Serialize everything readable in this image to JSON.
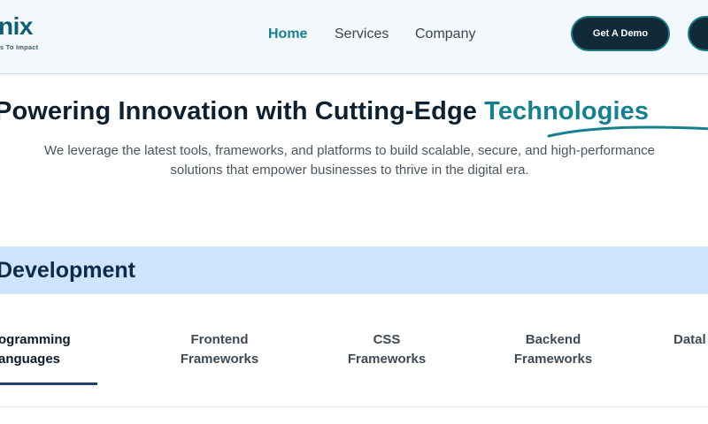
{
  "header": {
    "logo_text": "nix",
    "logo_tagline": "s To Impact",
    "nav": [
      {
        "label": "Home",
        "active": true
      },
      {
        "label": "Services",
        "active": false
      },
      {
        "label": "Company",
        "active": false
      }
    ],
    "cta_label": "Get A Demo"
  },
  "hero": {
    "title_main": "Powering Innovation with Cutting-Edge ",
    "title_accent": "Technologies",
    "description": "We leverage the latest tools, frameworks, and platforms to build scalable, secure, and high-performance solutions that empower businesses to thrive in the digital era."
  },
  "section": {
    "title": "Development"
  },
  "tabs": [
    {
      "line1": "ogramming",
      "line2": "anguages",
      "active": true
    },
    {
      "line1": "Frontend",
      "line2": "Frameworks",
      "active": false
    },
    {
      "line1": "CSS",
      "line2": "Frameworks",
      "active": false
    },
    {
      "line1": "Backend",
      "line2": "Frameworks",
      "active": false
    },
    {
      "line1": "Datal",
      "line2": "",
      "active": false
    }
  ],
  "colors": {
    "accent": "#17808f",
    "header_bg": "#f2f8fc",
    "section_band": "#cfe3fa",
    "dark_button": "#102a37"
  }
}
